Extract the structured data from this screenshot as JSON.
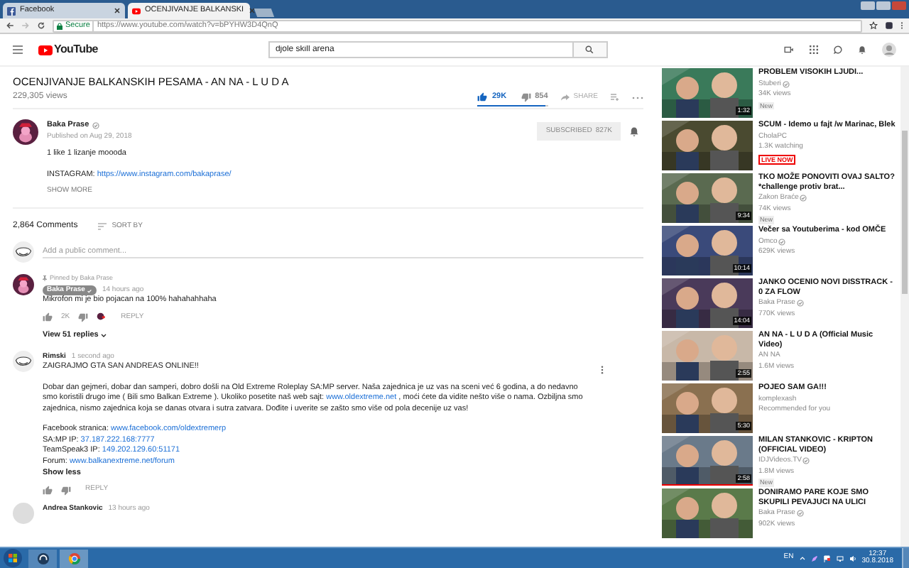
{
  "browser": {
    "tabs": [
      {
        "label": "Facebook",
        "selected": false
      },
      {
        "label": "OCENJIVANJE BALKANSKI",
        "selected": true
      }
    ],
    "secure_label": "Secure",
    "url": "https://www.youtube.com/watch?v=bPYHW3D4QnQ"
  },
  "header": {
    "logo": "YouTube",
    "search": {
      "value": "djole skill arena"
    }
  },
  "video": {
    "title": "OCENJIVANJE BALKANSKIH PESAMA - AN NA - L U D A",
    "views": "229,305 views",
    "likes": {
      "count": "29K",
      "selected": true
    },
    "dislikes": {
      "count": "854",
      "selected": false
    },
    "share": "SHARE",
    "sentiment": {
      "level": 0.97
    },
    "channel": {
      "name": "Baka Prase",
      "verified": true,
      "published": "Published on Aug 29, 2018",
      "subscribe": "SUBSCRIBED",
      "subscribers": "827K"
    },
    "description": [
      "1 like 1 lizanje moooda"
    ],
    "instagram": {
      "label": "INSTAGRAM:",
      "link": "https://www.instagram.com/bakaprase/"
    },
    "show_more": "SHOW MORE"
  },
  "comments": {
    "count": "2,864 Comments",
    "sort": "SORT BY",
    "placeholder": "Add a public comment...",
    "items": [
      {
        "pinned": "Pinned by Baka Prase",
        "author": "Baka Prase",
        "author_is_creator": true,
        "time": "14 hours ago",
        "lines": [
          {
            "parts": [
              {
                "text": "Mikrofon mi je bio pojacan na 100% hahahahhaha"
              }
            ]
          }
        ],
        "likes": "2K",
        "hearted": true,
        "reply": "REPLY",
        "replies": "View 51 replies"
      },
      {
        "author": "Rimski",
        "author_is_creator": false,
        "time": "1 second ago",
        "lines": [
          {
            "parts": [
              {
                "text": "ZAIGRAJMO GTA SAN ANDREAS ONLINE!!"
              }
            ],
            "gap": true
          },
          {
            "parts": [
              {
                "text": "Dobar dan gejmeri, dobar dan samperi, dobro došli na Old Extreme Roleplay SA:MP server. Naša zajednica je uz vas na sceni već 6 godina, a do nedavno smo koristili drugo ime ( Bili smo Balkan Extreme ). Ukoliko posetite naš web sajt: "
              },
              {
                "link": "www.oldextreme.net"
              },
              {
                "text": " , moći ćete da vidite nešto više o nama. Ozbiljna smo zajednica, nismo zajednica koja se danas otvara i sutra zatvara. Dođite i uverite se zašto smo više od pola decenije uz vas!"
              }
            ],
            "gap": true
          },
          {
            "parts": [
              {
                "text": "Facebook stranica: "
              },
              {
                "link": "www.facebook.com/oldextremerp"
              }
            ]
          },
          {
            "parts": [
              {
                "text": "SA:MP IP: "
              },
              {
                "link": "37.187.222.168:7777"
              }
            ]
          },
          {
            "parts": [
              {
                "text": "TeamSpeak3 IP: "
              },
              {
                "link": "149.202.129.60:51171"
              }
            ]
          },
          {
            "parts": [
              {
                "text": "Forum: "
              },
              {
                "link": "www.balkanextreme.net/forum"
              }
            ]
          }
        ],
        "show_less": "Show less",
        "hearted": false,
        "reply": "REPLY"
      },
      {
        "author": "Andrea Stankovic",
        "author_is_creator": false,
        "time": "13 hours ago"
      }
    ]
  },
  "sidebar": [
    {
      "title": "PROBLEM VISOKIH LJUDI...",
      "channel": "Stuberi",
      "verified": true,
      "meta": "34K views",
      "badge": {
        "kind": "new",
        "text": "New"
      },
      "duration": "1:32"
    },
    {
      "title": "SCUM - Idemo u fajt /w Marinac, Blek",
      "channel": "CholaPC",
      "verified": false,
      "meta": "1.3K watching",
      "badge": {
        "kind": "live",
        "text": "LIVE NOW"
      }
    },
    {
      "title": "TKO MOŽE PONOVITI OVAJ SALTO? *challenge protiv brat...",
      "channel": "Zakon Braće",
      "verified": true,
      "meta": "74K views",
      "badge": {
        "kind": "new",
        "text": "New"
      },
      "duration": "9:34"
    },
    {
      "title": "Večer sa Youtuberima - kod OMČE",
      "channel": "Omco",
      "verified": true,
      "meta": "629K views",
      "duration": "10:14"
    },
    {
      "title": "JANKO OCENIO NOVI DISSTRACK - 0 ZA FLOW",
      "channel": "Baka Prase",
      "verified": true,
      "meta": "770K views",
      "duration": "14:04"
    },
    {
      "title": "AN NA - L U D A (Official Music Video)",
      "channel": "AN NA",
      "verified": false,
      "meta": "1.6M views",
      "duration": "2:55"
    },
    {
      "title": "POJEO SAM GA!!!",
      "channel": "komplexash",
      "verified": false,
      "meta": "Recommended for you",
      "duration": "5:30"
    },
    {
      "title": "MILAN STANKOVIC - KRIPTON (OFFICIAL VIDEO)",
      "channel": "IDJVideos.TV",
      "verified": true,
      "meta": "1.8M views",
      "badge": {
        "kind": "new",
        "text": "New"
      },
      "duration": "2:58",
      "watched": {
        "level": 1
      }
    },
    {
      "title": "DONIRAMO PARE KOJE SMO SKUPILI PEVAJUCI NA ULICI",
      "channel": "Baka Prase",
      "verified": true,
      "meta": "902K views"
    }
  ],
  "taskbar": {
    "language": "EN",
    "time": "12:37",
    "date": "30.8.2018"
  }
}
